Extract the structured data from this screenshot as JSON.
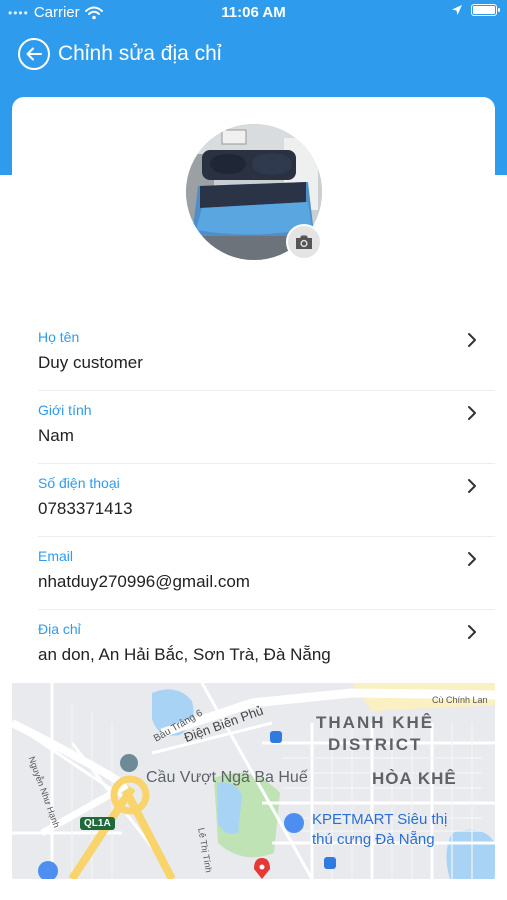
{
  "status_bar": {
    "carrier": "Carrier",
    "time": "11:06 AM"
  },
  "nav": {
    "title": "Chỉnh sửa địa chỉ"
  },
  "fields": [
    {
      "label": "Họ tên",
      "value": "Duy customer"
    },
    {
      "label": "Giới tính",
      "value": "Nam"
    },
    {
      "label": "Số điện thoại",
      "value": "0783371413"
    },
    {
      "label": "Email",
      "value": "nhatduy270996@gmail.com"
    },
    {
      "label": "Địa chỉ",
      "value": "an don, An Hải Bắc, Sơn Trà, Đà Nẵng"
    }
  ],
  "map": {
    "street_bau_trang": "Bàu Trảng 6",
    "street_dien_bien_phu": "Điện Biên Phủ",
    "street_nguyen_nhu_hanh": "Nguyễn Như Hạnh",
    "street_cu_chinh_lan": "Cù Chính Lan",
    "street_le_thi_tinh": "Lê Thị Tính",
    "district_line1": "THANH KHÊ",
    "district_line2": "DISTRICT",
    "ward": "HÒA KHÊ",
    "landmark": "Cầu Vượt Ngã Ba Huế",
    "shop_line1": "KPETMART Siêu thị",
    "shop_line2": "thú cưng Đà Nẵng",
    "road_badge": "QL1A"
  },
  "colors": {
    "primary": "#2f9bec",
    "label": "#2f9bec",
    "text": "#222222"
  }
}
